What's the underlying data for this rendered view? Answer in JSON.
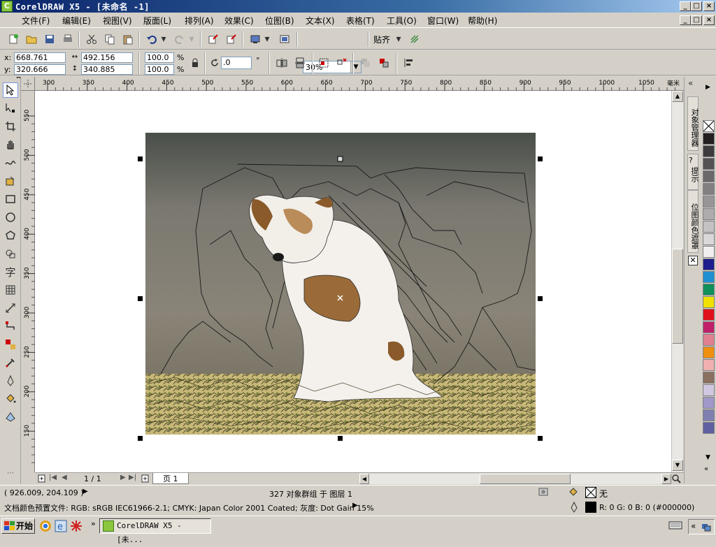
{
  "window": {
    "title": "CorelDRAW X5 - [未命名 -1]",
    "app_icon_glyph": "C",
    "controls": [
      "_",
      "□",
      "×"
    ],
    "doc_controls": [
      "_",
      "□",
      "×"
    ]
  },
  "menu": {
    "items": [
      "文件(F)",
      "编辑(E)",
      "视图(V)",
      "版面(L)",
      "排列(A)",
      "效果(C)",
      "位图(B)",
      "文本(X)",
      "表格(T)",
      "工具(O)",
      "窗口(W)",
      "帮助(H)"
    ]
  },
  "toolbar1": {
    "zoom_value": "30%",
    "snap_label": "贴齐"
  },
  "property_bar": {
    "x_label": "x:",
    "y_label": "y:",
    "x_value": "668.761 mm",
    "y_value": "320.666 mm",
    "width_value": "492.156 mm",
    "height_value": "340.885 mm",
    "scale_x": "100.0",
    "scale_y": "100.0",
    "percent_symbol": "%",
    "rotation_value": ".0",
    "degree_symbol": "°"
  },
  "ruler": {
    "unit": "毫米",
    "h_ticks": [
      "300",
      "350",
      "400",
      "450",
      "500",
      "550",
      "600",
      "650",
      "700",
      "750",
      "800",
      "850",
      "900",
      "950",
      "1000",
      "1050"
    ],
    "v_ticks": [
      "550",
      "500",
      "450",
      "400",
      "350",
      "300",
      "250",
      "200",
      "150"
    ]
  },
  "docker": {
    "tabs": [
      "对象管理器",
      "提示",
      "位图颜色遮罩"
    ]
  },
  "palette": {
    "colors": [
      "#231f20",
      "#3d3b3c",
      "#545253",
      "#6b696a",
      "#828081",
      "#989697",
      "#aeacad",
      "#c4c2c3",
      "#dad8d9",
      "#f0eeef",
      "#1e1e8c",
      "#2090d0",
      "#10905a",
      "#f0e000",
      "#e0101a",
      "#c0206a",
      "#e08090",
      "#f09010",
      "#f0b0b0",
      "#8a7060",
      "#d0c8e0",
      "#a098c8",
      "#8080b0",
      "#6060a0"
    ]
  },
  "page_nav": {
    "page_count": "1 / 1",
    "page_tab": "页 1"
  },
  "status": {
    "cursor_coords": "( 926.009, 204.109 )",
    "selection_info": "327 对象群组 于 图层 1",
    "color_profile": "文档颜色预置文件: RGB: sRGB IEC61966-2.1; CMYK: Japan Color 2001 Coated; 灰度: Dot Gain 15%",
    "fill_none": "无",
    "outline_info": "R: 0 G: 0 B: 0 (#000000)"
  },
  "taskbar": {
    "start_label": "开始",
    "task_label": "CorelDRAW X5 - [未..."
  }
}
